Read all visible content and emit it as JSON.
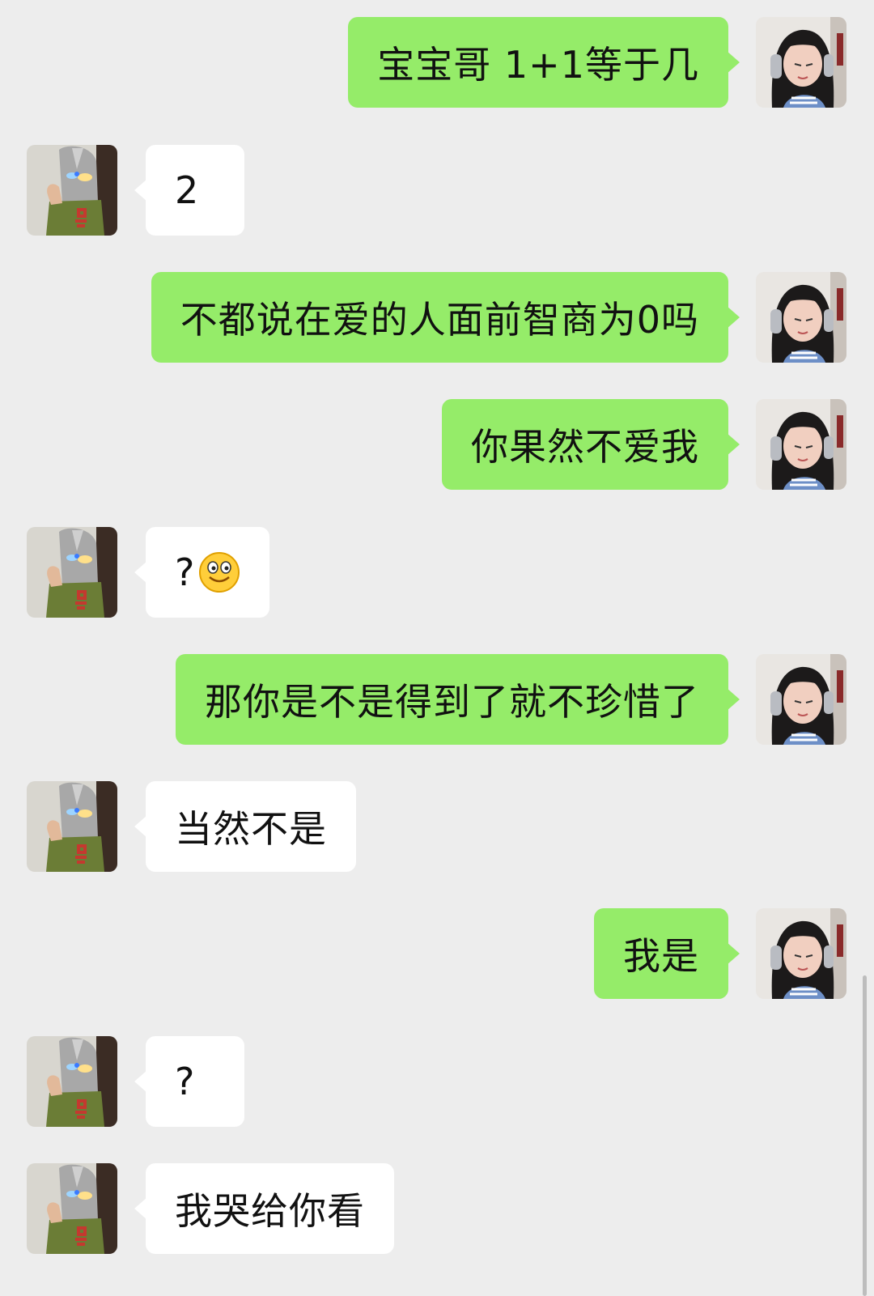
{
  "conversation": {
    "messages": [
      {
        "side": "right",
        "text": "宝宝哥 1+1等于几"
      },
      {
        "side": "left",
        "text": "2"
      },
      {
        "side": "right",
        "text": "不都说在爱的人面前智商为0吗"
      },
      {
        "side": "right",
        "text": "你果然不爱我"
      },
      {
        "side": "left",
        "text": "?",
        "emoji": "smiley-face-icon"
      },
      {
        "side": "right",
        "text": "那你是不是得到了就不珍惜了"
      },
      {
        "side": "left",
        "text": "当然不是"
      },
      {
        "side": "right",
        "text": "我是"
      },
      {
        "side": "left",
        "text": "?"
      },
      {
        "side": "left",
        "text": "我哭给你看"
      }
    ]
  },
  "colors": {
    "background": "#ededed",
    "sent_bubble": "#95ec69",
    "received_bubble": "#ffffff"
  }
}
